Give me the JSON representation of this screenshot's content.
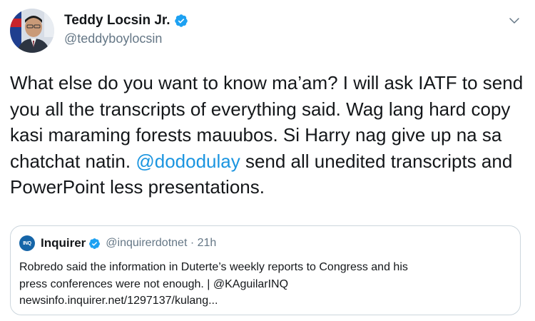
{
  "author": {
    "display_name": "Teddy Locsin Jr.",
    "handle": "@teddyboylocsin"
  },
  "tweet": {
    "text_before_mention": "What else do you want to know ma’am? I will ask IATF to send you all the transcripts of everything said. Wag lang hard copy kasi maraming forests mauubos. Si Harry nag give up na sa chatchat natin. ",
    "mention": "@dododulay",
    "text_after_mention": " send all unedited transcripts and PowerPoint less presentations."
  },
  "quoted_tweet": {
    "avatar_text": "INQ",
    "display_name": "Inquirer",
    "handle_time": "@inquirerdotnet · 21h",
    "text_line1": "Robredo said the information in Duterte’s weekly reports to Congress and his",
    "text_line2": "press conferences were not enough. | @KAguilarINQ",
    "text_line3": "newsinfo.inquirer.net/1297137/kulang..."
  },
  "colors": {
    "link": "#1b95e0",
    "verified": "#1da1f2",
    "secondary_text": "#657786",
    "border": "#ccd6dd"
  },
  "icons": [
    "verified-badge-icon",
    "chevron-down-icon"
  ]
}
